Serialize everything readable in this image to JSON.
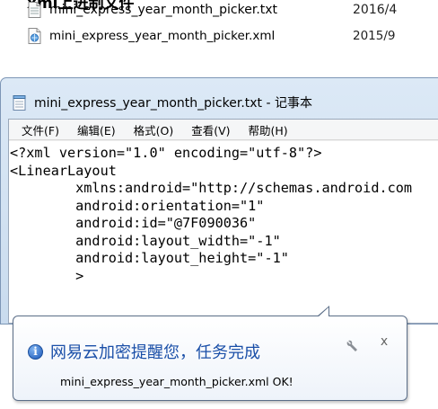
{
  "heading": "xml上进制文件",
  "files": [
    {
      "name": "mini_express_year_month_picker.txt",
      "date": "2016/4",
      "icon": "text-file-icon"
    },
    {
      "name": "mini_express_year_month_picker.xml",
      "date": "2015/9",
      "icon": "xml-file-icon"
    }
  ],
  "notepad": {
    "title": "mini_express_year_month_picker.txt - 记事本",
    "menu": [
      "文件(F)",
      "编辑(E)",
      "格式(O)",
      "查看(V)",
      "帮助(H)"
    ],
    "lines": [
      "<?xml version=\"1.0\" encoding=\"utf-8\"?>",
      "<LinearLayout",
      "        xmlns:android=\"http://schemas.android.com",
      "        android:orientation=\"1\"",
      "        android:id=\"@7F090036\"",
      "        android:layout_width=\"-1\"",
      "        android:layout_height=\"-1\"",
      "        >"
    ]
  },
  "notification": {
    "title": "网易云加密提醒您，任务完成",
    "message": "mini_express_year_month_picker.xml OK!",
    "close_label": "x"
  },
  "colors": {
    "title_blue": "#1a4fa8",
    "window_frame": "#c9dbee"
  }
}
